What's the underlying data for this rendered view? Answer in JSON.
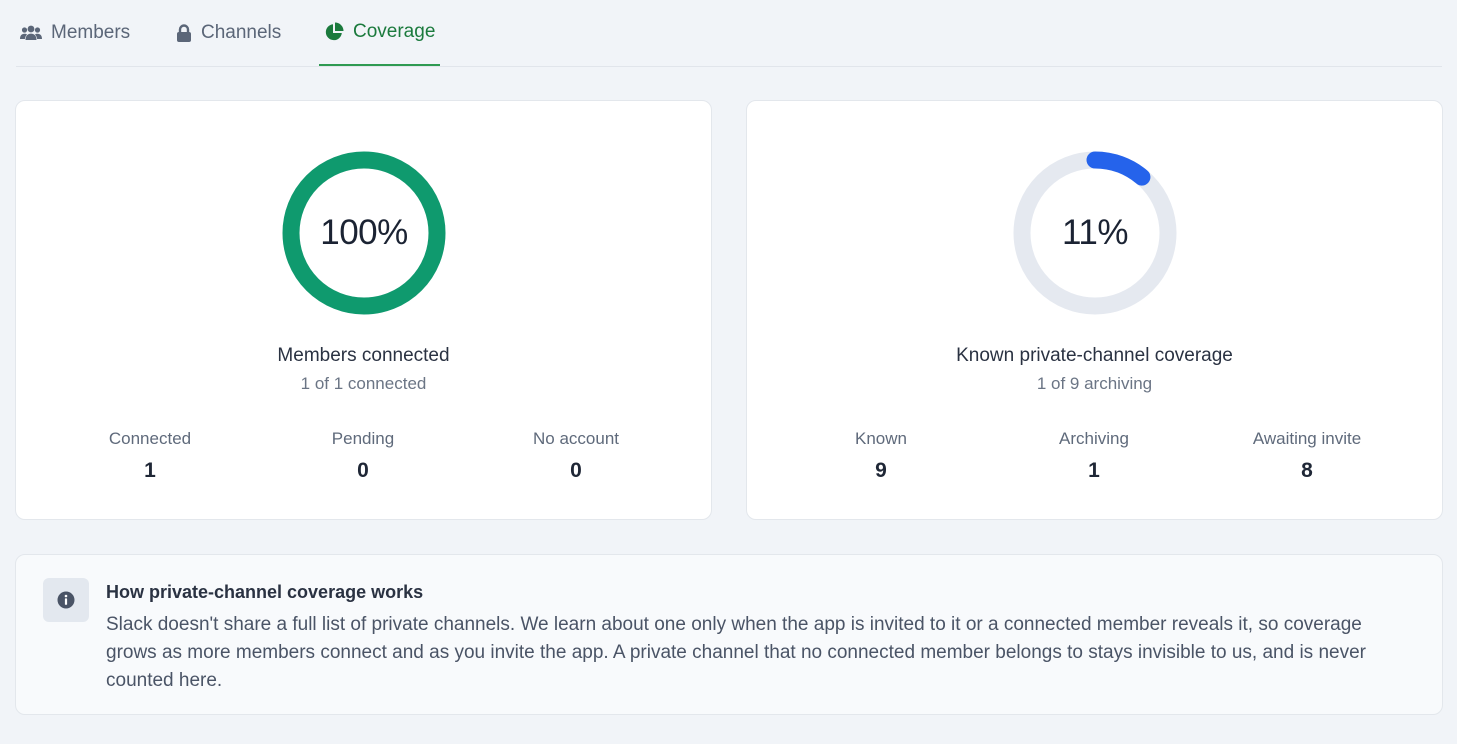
{
  "tabs": [
    {
      "label": "Members",
      "icon": "users-icon",
      "active": false
    },
    {
      "label": "Channels",
      "icon": "lock-icon",
      "active": false
    },
    {
      "label": "Coverage",
      "icon": "pie-chart-icon",
      "active": true
    }
  ],
  "colors": {
    "members_ring": "#0f9a6e",
    "channels_ring": "#2563eb",
    "ring_track": "#e5e9f0",
    "active_tab": "#1b7a3d"
  },
  "members_card": {
    "percent_label": "100%",
    "percent_value": 1.0,
    "title": "Members connected",
    "subtitle": "1 of 1 connected",
    "stats": [
      {
        "label": "Connected",
        "value": "1"
      },
      {
        "label": "Pending",
        "value": "0"
      },
      {
        "label": "No account",
        "value": "0"
      }
    ]
  },
  "channels_card": {
    "percent_label": "11%",
    "percent_value": 0.1111,
    "title": "Known private-channel coverage",
    "subtitle": "1 of 9 archiving",
    "stats": [
      {
        "label": "Known",
        "value": "9"
      },
      {
        "label": "Archiving",
        "value": "1"
      },
      {
        "label": "Awaiting invite",
        "value": "8"
      }
    ]
  },
  "info": {
    "icon": "info-icon",
    "title": "How private-channel coverage works",
    "body": "Slack doesn't share a full list of private channels. We learn about one only when the app is invited to it or a connected member reveals it, so coverage grows as more members connect and as you invite the app. A private channel that no connected member belongs to stays invisible to us, and is never counted here."
  }
}
